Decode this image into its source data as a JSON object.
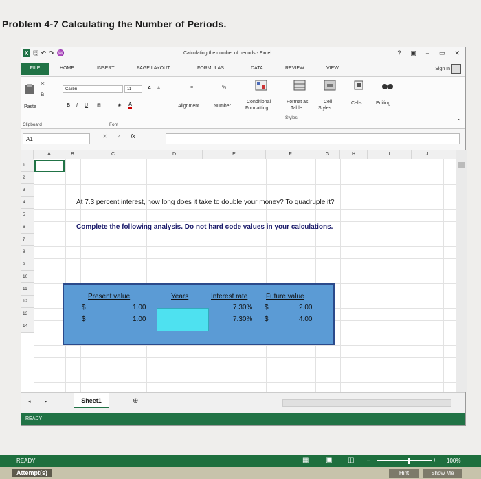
{
  "problem_title": "Problem 4-7 Calculating the Number of Periods.",
  "window": {
    "title": "Calculating the number of periods - Excel",
    "controls": [
      "?",
      "▣",
      "–",
      "▭",
      "✕"
    ],
    "qat": [
      "↶",
      "↷",
      "♒"
    ]
  },
  "tabs": {
    "file": "FILE",
    "items": [
      "HOME",
      "INSERT",
      "PAGE LAYOUT",
      "FORMULAS",
      "DATA",
      "REVIEW",
      "VIEW"
    ],
    "sign_in": "Sign In"
  },
  "ribbon": {
    "paste": "Paste",
    "clipboard": "Clipboard",
    "font_name": "Calibri",
    "font_size": "11",
    "grow": "A",
    "shrink": "A",
    "bold": "B",
    "italic": "I",
    "underline": "U",
    "font_color": "A",
    "font": "Font",
    "alignment": "Alignment",
    "number": "Number",
    "percent": "%",
    "cond_format_1": "Conditional",
    "cond_format_2": "Formatting",
    "format_table_1": "Format as",
    "format_table_2": "Table",
    "cell_styles_1": "Cell",
    "cell_styles_2": "Styles",
    "styles": "Styles",
    "cells": "Cells",
    "editing": "Editing"
  },
  "formula_bar": {
    "name_box": "A1",
    "cancel": "✕",
    "enter": "✓",
    "fx": "fx",
    "formula": ""
  },
  "columns": [
    "A",
    "B",
    "C",
    "D",
    "E",
    "F",
    "G",
    "H",
    "I",
    "J"
  ],
  "rows": [
    "1",
    "2",
    "3",
    "4",
    "5",
    "6",
    "7",
    "8",
    "9",
    "10",
    "11",
    "12",
    "13",
    "14"
  ],
  "cells": {
    "question": "At 7.3 percent interest, how long does it take to double your money? To quadruple it?",
    "instruction": "Complete the following analysis. Do not hard code values in your calculations."
  },
  "analysis": {
    "headers": {
      "present_value": "Present value",
      "years": "Years",
      "interest_rate": "Interest rate",
      "future_value": "Future value"
    },
    "rows": [
      {
        "pv_symbol": "$",
        "pv": "1.00",
        "rate": "7.30%",
        "fv_symbol": "$",
        "fv": "2.00"
      },
      {
        "pv_symbol": "$",
        "pv": "1.00",
        "rate": "7.30%",
        "fv_symbol": "$",
        "fv": "4.00"
      }
    ]
  },
  "sheet_bar": {
    "prev": "◂",
    "next": "▸",
    "more_left": "...",
    "sheet_name": "Sheet1",
    "more_right": "...",
    "add": "⊕"
  },
  "status": {
    "ready": "READY",
    "zoom": "100%",
    "minus": "–",
    "plus": "+"
  },
  "footer": {
    "attempts": "Attempt(s)",
    "hint": "Hint",
    "show_me": "Show Me"
  }
}
